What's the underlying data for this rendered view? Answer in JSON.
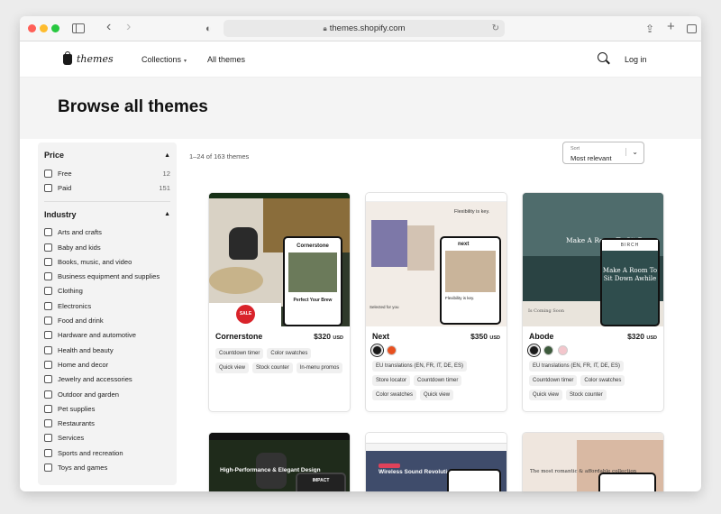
{
  "browser": {
    "url": "themes.shopify.com"
  },
  "header": {
    "logo_text": "themes",
    "nav": [
      {
        "label": "Collections"
      },
      {
        "label": "All themes"
      }
    ],
    "login_label": "Log in"
  },
  "hero": {
    "title": "Browse all themes"
  },
  "filters": {
    "price": {
      "title": "Price",
      "options": [
        {
          "label": "Free",
          "count": "12"
        },
        {
          "label": "Paid",
          "count": "151"
        }
      ]
    },
    "industry": {
      "title": "Industry",
      "options": [
        {
          "label": "Arts and crafts"
        },
        {
          "label": "Baby and kids"
        },
        {
          "label": "Books, music, and video"
        },
        {
          "label": "Business equipment and supplies"
        },
        {
          "label": "Clothing"
        },
        {
          "label": "Electronics"
        },
        {
          "label": "Food and drink"
        },
        {
          "label": "Hardware and automotive"
        },
        {
          "label": "Health and beauty"
        },
        {
          "label": "Home and decor"
        },
        {
          "label": "Jewelry and accessories"
        },
        {
          "label": "Outdoor and garden"
        },
        {
          "label": "Pet supplies"
        },
        {
          "label": "Restaurants"
        },
        {
          "label": "Services"
        },
        {
          "label": "Sports and recreation"
        },
        {
          "label": "Toys and games"
        }
      ]
    }
  },
  "results": {
    "count_text": "1–24 of 163 themes",
    "sort_label": "Sort",
    "sort_value": "Most relevant"
  },
  "themes": [
    {
      "name": "Cornerstone",
      "price": "$320",
      "currency": "USD",
      "swatches": [],
      "tags": [
        "Countdown timer",
        "Color swatches",
        "Quick view",
        "Stock counter",
        "In-menu promos"
      ],
      "thumb": {
        "phone_title": "Cornerstone",
        "phone_caption": "Perfect Your Brew",
        "badge": "SALE"
      }
    },
    {
      "name": "Next",
      "price": "$350",
      "currency": "USD",
      "swatches": [
        "#1a1a1a",
        "#e8501f"
      ],
      "tags": [
        "EU translations (EN, FR, IT, DE, ES)",
        "Store locator",
        "Countdown timer",
        "Color swatches",
        "Quick view"
      ],
      "thumb": {
        "headline": "Flexibility is key.",
        "phone_logo": "next",
        "phone_caption": "Flexibility is key.",
        "selected": "Selected for you"
      }
    },
    {
      "name": "Abode",
      "price": "$320",
      "currency": "USD",
      "swatches": [
        "#1a1a1a",
        "#3d5a3c",
        "#f3c6cc"
      ],
      "tags": [
        "EU translations (EN, FR, IT, DE, ES)",
        "Countdown timer",
        "Color swatches",
        "Quick view",
        "Stock counter"
      ],
      "thumb": {
        "text": "Make A Room To Sit Down",
        "phone_logo": "BIRCH",
        "phone_text": "Make A Room To Sit Down Awhile",
        "coming": "Is Coming Soon"
      }
    }
  ],
  "more_themes": [
    {
      "headline": "High-Performance & Elegant Design",
      "phone_label": "IMPACT"
    },
    {
      "headline": "Wireless Sound Revolution",
      "pill": "Wireless"
    },
    {
      "headline": "The most romantic & affordable collection"
    }
  ]
}
